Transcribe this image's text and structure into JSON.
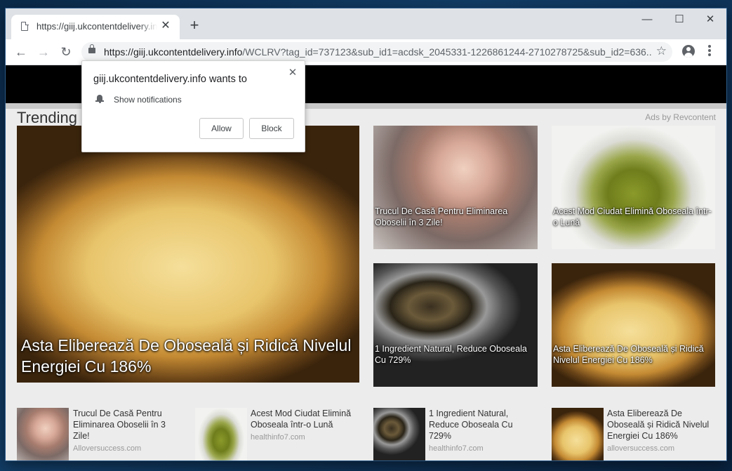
{
  "browser": {
    "tab": {
      "title": "https://giij.ukcontentdelivery.info"
    },
    "url": {
      "domain": "https://giij.ukcontentdelivery.info",
      "path": "/WCLRV?tag_id=737123&sub_id1=acdsk_2045331-1226861244-2710278725&sub_id2=636..."
    },
    "controls": {
      "minimize": "—",
      "maximize": "☐",
      "close": "✕",
      "new_tab": "+",
      "tab_close": "✕"
    }
  },
  "page": {
    "heading": "Trending",
    "ads_label": "Ads by Revcontent",
    "featured": {
      "caption": "Asta Eliberează De Oboseală și Ridică Nivelul Energiei Cu 186%"
    },
    "grid": [
      {
        "caption": "Trucul De Casă Pentru Eliminarea Oboselii în 3 Zile!",
        "image": "elderly-woman-smiling"
      },
      {
        "caption": "Acest Mod Ciudat Elimină Oboseala într-o Lună",
        "image": "green-spiky-plant"
      },
      {
        "caption": "1 Ingredient Natural, Reduce Oboseala Cu 729%",
        "image": "spoon-of-seeds"
      },
      {
        "caption": "Asta Eliberează De Oboseală și Ridică Nivelul Energiei Cu 186%",
        "image": "squash-closeup"
      }
    ],
    "list": [
      {
        "title": "Trucul De Casă Pentru Eliminarea Oboselii în 3 Zile!",
        "source": "Alloversuccess.com"
      },
      {
        "title": "Acest Mod Ciudat Elimină Oboseala într-o Lună",
        "source": "healthinfo7.com"
      },
      {
        "title": "1 Ingredient Natural, Reduce Oboseala Cu 729%",
        "source": "healthinfo7.com"
      },
      {
        "title": "Asta Eliberează De Oboseală și Ridică Nivelul Energiei Cu 186%",
        "source": "alloversuccess.com"
      }
    ]
  },
  "popup": {
    "title": "giij.ukcontentdelivery.info wants to",
    "permission": "Show notifications",
    "allow_label": "Allow",
    "block_label": "Block",
    "close": "✕"
  }
}
